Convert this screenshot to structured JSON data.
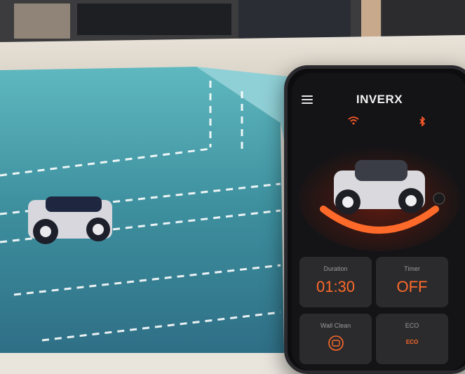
{
  "app": {
    "title": "INVERX",
    "status_icons": [
      "wifi-icon",
      "bluetooth-icon"
    ],
    "accent_color": "#ff6a2a"
  },
  "robot_visual": {
    "badge": "",
    "progress_fraction": 0.75
  },
  "tiles": [
    {
      "label": "Duration",
      "value": "01:30"
    },
    {
      "label": "Timer",
      "value": "OFF"
    },
    {
      "label": "Wall Clean",
      "icon": "wall-clean-icon"
    },
    {
      "label": "ECO",
      "value": "ECO"
    }
  ]
}
